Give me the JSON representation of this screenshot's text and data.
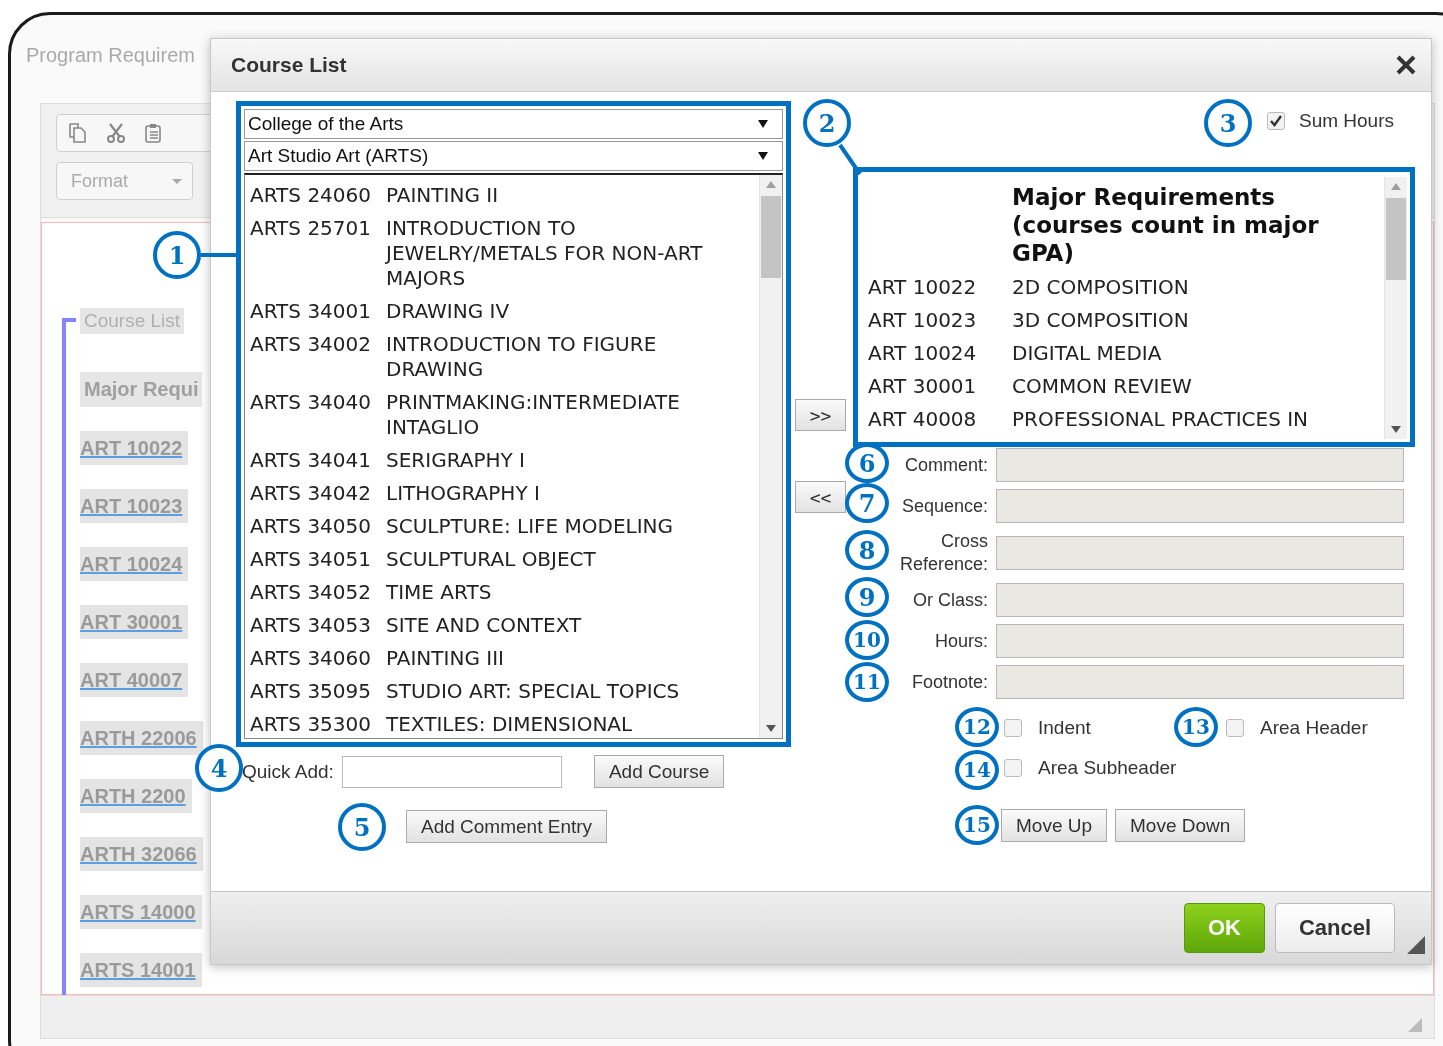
{
  "background_window": {
    "title": "Program Requirem",
    "format_dropdown": "Format",
    "legend": "Course List",
    "heading": "Major Requi",
    "links": [
      "ART 10022",
      "ART 10023",
      "ART 10024",
      "ART 30001",
      "ART 40007",
      "ARTH 22006",
      "ARTH 2200",
      "ARTH 32066",
      "ARTS 14000",
      "ARTS 14001"
    ]
  },
  "dialog": {
    "title": "Course List",
    "college_select": "College of the Arts",
    "subject_select": "Art Studio Art (ARTS)",
    "available_courses": [
      {
        "code": "ARTS 24060",
        "title": "PAINTING II"
      },
      {
        "code": "ARTS 25701",
        "title": "INTRODUCTION TO JEWELRY/METALS FOR NON-ART MAJORS"
      },
      {
        "code": "ARTS 34001",
        "title": "DRAWING IV"
      },
      {
        "code": "ARTS 34002",
        "title": "INTRODUCTION TO FIGURE DRAWING"
      },
      {
        "code": "ARTS 34040",
        "title": "PRINTMAKING:INTERMEDIATE INTAGLIO"
      },
      {
        "code": "ARTS 34041",
        "title": "SERIGRAPHY I"
      },
      {
        "code": "ARTS 34042",
        "title": "LITHOGRAPHY I"
      },
      {
        "code": "ARTS 34050",
        "title": "SCULPTURE: LIFE MODELING"
      },
      {
        "code": "ARTS 34051",
        "title": "SCULPTURAL OBJECT"
      },
      {
        "code": "ARTS 34052",
        "title": "TIME ARTS"
      },
      {
        "code": "ARTS 34053",
        "title": "SITE AND CONTEXT"
      },
      {
        "code": "ARTS 34060",
        "title": "PAINTING III"
      },
      {
        "code": "ARTS 35095",
        "title": "STUDIO ART: SPECIAL TOPICS"
      },
      {
        "code": "ARTS 35300",
        "title": "TEXTILES: DIMENSIONAL"
      }
    ],
    "quick_add_label": "Quick Add:",
    "add_course_button": "Add Course",
    "add_comment_button": "Add Comment Entry",
    "move_right_button": ">>",
    "move_left_button": "<<",
    "sum_hours": {
      "label": "Sum Hours",
      "checked": true
    },
    "selected_courses": [
      {
        "kind": "heading",
        "title": "Major Requirements (courses count in major GPA)"
      },
      {
        "kind": "course",
        "code": "ART 10022",
        "title": "2D COMPOSITION"
      },
      {
        "kind": "course",
        "code": "ART 10023",
        "title": "3D COMPOSITION"
      },
      {
        "kind": "course",
        "code": "ART 10024",
        "title": "DIGITAL MEDIA"
      },
      {
        "kind": "course",
        "code": "ART 30001",
        "title": "COMMON REVIEW"
      },
      {
        "kind": "course",
        "code": "ART 40008",
        "title": "PROFESSIONAL PRACTICES IN"
      }
    ],
    "fields": [
      {
        "label": "Comment:"
      },
      {
        "label": "Sequence:"
      },
      {
        "label": "Cross Reference:"
      },
      {
        "label": "Or Class:"
      },
      {
        "label": "Hours:"
      },
      {
        "label": "Footnote:"
      }
    ],
    "options": [
      {
        "label": "Indent",
        "checked": false
      },
      {
        "label": "Area Header",
        "checked": false
      },
      {
        "label": "Area Subheader",
        "checked": false
      }
    ],
    "move_up_button": "Move Up",
    "move_down_button": "Move Down",
    "ok_button": "OK",
    "cancel_button": "Cancel"
  },
  "callouts": [
    {
      "number": "1"
    },
    {
      "number": "2"
    },
    {
      "number": "3"
    },
    {
      "number": "4"
    },
    {
      "number": "5"
    },
    {
      "number": "6"
    },
    {
      "number": "7"
    },
    {
      "number": "8"
    },
    {
      "number": "9"
    },
    {
      "number": "10"
    },
    {
      "number": "11"
    },
    {
      "number": "12"
    },
    {
      "number": "13"
    },
    {
      "number": "14"
    },
    {
      "number": "15"
    }
  ]
}
